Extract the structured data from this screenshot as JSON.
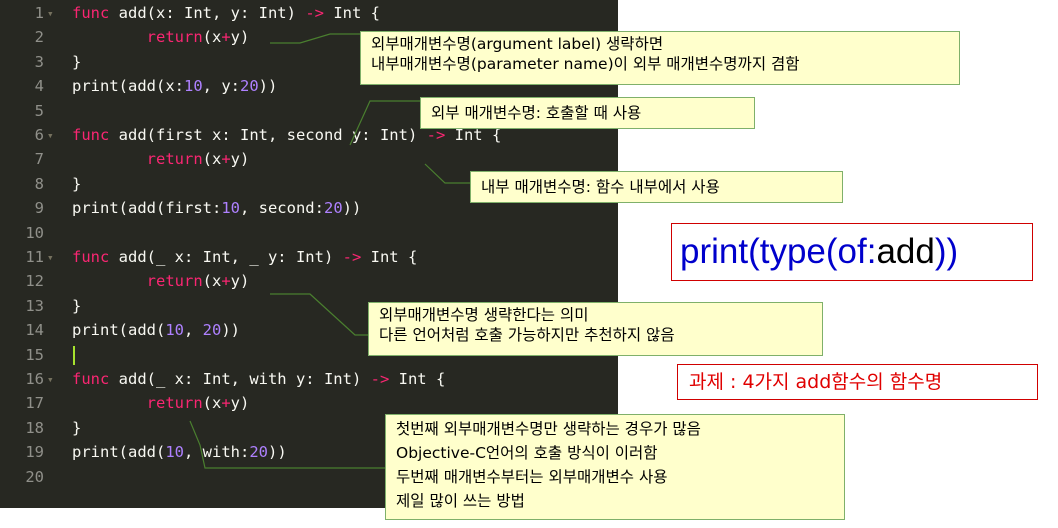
{
  "editor": {
    "lines": [
      {
        "n": "1",
        "code": [
          [
            "kw",
            "func"
          ],
          [
            "",
            "add(x: Int, y: Int) "
          ],
          [
            "kw",
            "->"
          ],
          [
            "",
            " Int {"
          ]
        ],
        "fold": true
      },
      {
        "n": "2",
        "code": [
          [
            "",
            "        "
          ],
          [
            "kw",
            "return"
          ],
          [
            "",
            "(x"
          ],
          [
            "kw",
            "+"
          ],
          [
            "",
            "y)"
          ]
        ]
      },
      {
        "n": "3",
        "code": [
          [
            "",
            "}"
          ]
        ]
      },
      {
        "n": "4",
        "code": [
          [
            "",
            "print(add(x:"
          ],
          [
            "num",
            "10"
          ],
          [
            "",
            ", y:"
          ],
          [
            "num",
            "20"
          ],
          [
            "",
            "))"
          ]
        ]
      },
      {
        "n": "5",
        "code": []
      },
      {
        "n": "6",
        "code": [
          [
            "kw",
            "func"
          ],
          [
            "",
            "add(first x: Int, second y: Int) "
          ],
          [
            "kw",
            "->"
          ],
          [
            "",
            " Int {"
          ]
        ],
        "fold": true
      },
      {
        "n": "7",
        "code": [
          [
            "",
            "        "
          ],
          [
            "kw",
            "return"
          ],
          [
            "",
            "(x"
          ],
          [
            "kw",
            "+"
          ],
          [
            "",
            "y)"
          ]
        ]
      },
      {
        "n": "8",
        "code": [
          [
            "",
            "}"
          ]
        ]
      },
      {
        "n": "9",
        "code": [
          [
            "",
            "print(add(first:"
          ],
          [
            "num",
            "10"
          ],
          [
            "",
            ", second:"
          ],
          [
            "num",
            "20"
          ],
          [
            "",
            "))"
          ]
        ]
      },
      {
        "n": "10",
        "code": []
      },
      {
        "n": "11",
        "code": [
          [
            "kw",
            "func"
          ],
          [
            "",
            "add(_ x: Int, _ y: Int) "
          ],
          [
            "kw",
            "->"
          ],
          [
            "",
            " Int {"
          ]
        ],
        "fold": true
      },
      {
        "n": "12",
        "code": [
          [
            "",
            "        "
          ],
          [
            "kw",
            "return"
          ],
          [
            "",
            "(x"
          ],
          [
            "kw",
            "+"
          ],
          [
            "",
            "y)"
          ]
        ]
      },
      {
        "n": "13",
        "code": [
          [
            "",
            "}"
          ]
        ]
      },
      {
        "n": "14",
        "code": [
          [
            "",
            "print(add("
          ],
          [
            "num",
            "10"
          ],
          [
            "",
            ", "
          ],
          [
            "num",
            "20"
          ],
          [
            "",
            "))"
          ]
        ]
      },
      {
        "n": "15",
        "code": [],
        "cursor": true
      },
      {
        "n": "16",
        "code": [
          [
            "kw",
            "func"
          ],
          [
            "",
            "add(_ x: Int, with y: Int) "
          ],
          [
            "kw",
            "->"
          ],
          [
            "",
            " Int {"
          ]
        ],
        "fold": true
      },
      {
        "n": "17",
        "code": [
          [
            "",
            "        "
          ],
          [
            "kw",
            "return"
          ],
          [
            "",
            "(x"
          ],
          [
            "kw",
            "+"
          ],
          [
            "",
            "y)"
          ]
        ]
      },
      {
        "n": "18",
        "code": [
          [
            "",
            "}"
          ]
        ]
      },
      {
        "n": "19",
        "code": [
          [
            "",
            "print(add("
          ],
          [
            "num",
            "10"
          ],
          [
            "",
            ", with:"
          ],
          [
            "num",
            "20"
          ],
          [
            "",
            "))"
          ]
        ]
      },
      {
        "n": "20",
        "code": []
      }
    ]
  },
  "notes": {
    "n1_l1": "외부매개변수명(argument label) 생략하면",
    "n1_l2": "내부매개변수명(parameter name)이 외부 매개변수명까지 겸함",
    "n2": "외부 매개변수명: 호출할 때 사용",
    "n3": "내부 매개변수명: 함수 내부에서 사용",
    "n4_l1": "외부매개변수명 생략한다는 의미",
    "n4_l2": "다른 언어처럼 호출 가능하지만 추천하지 않음",
    "n5_l1": "첫번째 외부매개변수명만 생략하는 경우가 많음",
    "n5_l2": "Objective-C언어의 호출 방식이 이러함",
    "n5_l3": "두번째 매개변수부터는 외부매개변수 사용",
    "n5_l4": "제일 많이 쓰는 방법"
  },
  "callout": {
    "part1": "print(type(of:",
    "part2": "add",
    "part3": "))"
  },
  "task": "과제 : 4가지 add함수의 함수명",
  "colors": {
    "keyword": "#f92672",
    "number": "#ae81ff",
    "text": "#f8f8f2",
    "bg": "#272822",
    "note_bg": "#ffffcc",
    "accent_red": "#d00000"
  }
}
